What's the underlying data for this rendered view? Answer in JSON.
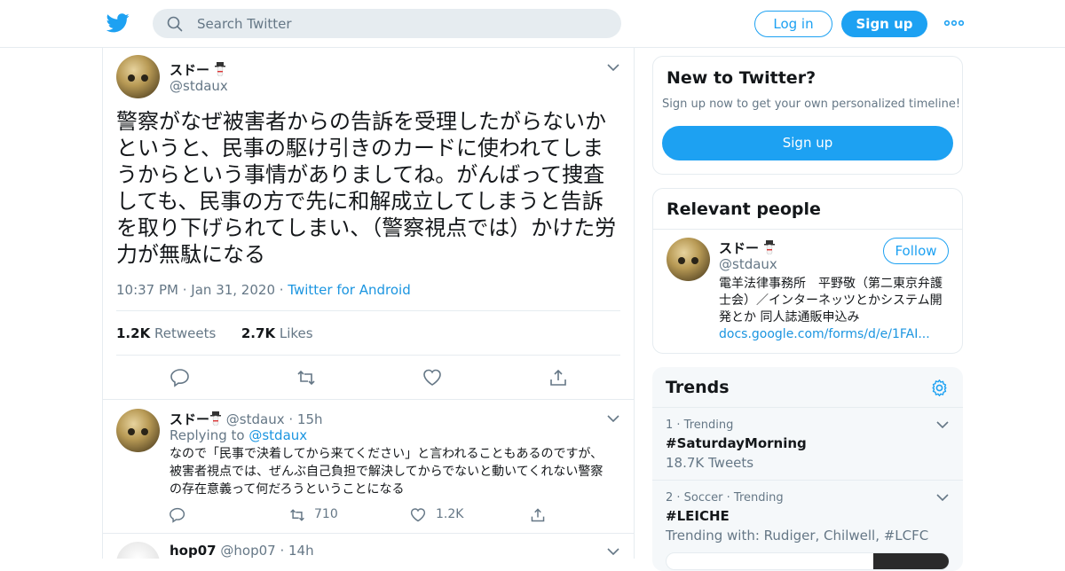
{
  "header": {
    "search_placeholder": "Search Twitter",
    "login_label": "Log in",
    "signup_label": "Sign up",
    "brand_color": "#1da1f2"
  },
  "tweet": {
    "author_name": "スドー",
    "author_handle": "@stdaux",
    "text": "警察がなぜ被害者からの告訴を受理したがらないかというと、民事の駆け引きのカードに使われてしまうからという事情がありましてね。がんばって捜査しても、民事の方で先に和解成立してしまうと告訴を取り下げられてしまい、（警察視点では）かけた労力が無駄になる",
    "time": "10:37 PM",
    "date": "Jan 31, 2020",
    "source": "Twitter for Android",
    "retweets_count": "1.2K",
    "retweets_label": "Retweets",
    "likes_count": "2.7K",
    "likes_label": "Likes"
  },
  "reply1": {
    "author_name": "スドー",
    "author_handle": "@stdaux",
    "age": "15h",
    "replying_prefix": "Replying to",
    "replying_to": "@stdaux",
    "text": "なので「民事で決着してから来てください」と言われることもあるのですが、被害者視点では、ぜんぶ自己負担で解決してからでないと動いてくれない警察の存在意義って何だろうということになる",
    "retweets": "710",
    "likes": "1.2K"
  },
  "reply2": {
    "author_name": "hop07",
    "author_handle": "@hop07",
    "age": "14h"
  },
  "sidebar": {
    "new_title": "New to Twitter?",
    "new_sub": "Sign up now to get your own personalized timeline!",
    "new_signup": "Sign up",
    "relevant_title": "Relevant people",
    "person_name": "スドー",
    "person_handle": "@stdaux",
    "follow_label": "Follow",
    "person_bio": "電羊法律事務所　平野敬（第二東京弁護士会）／インターネッツとかシステム開発とか 同人誌通販申込み",
    "person_link": "docs.google.com/forms/d/e/1FAI...",
    "trends_title": "Trends",
    "trends": [
      {
        "meta": "1 · Trending",
        "tag": "#SaturdayMorning",
        "sub": "18.7K Tweets"
      },
      {
        "meta": "2 · Soccer · Trending",
        "tag": "#LEICHE",
        "sub": "Trending with: Rudiger, Chilwell, #LCFC"
      }
    ]
  },
  "icons": [
    "twitter-bird-icon",
    "search-icon",
    "more-icon",
    "chevron-down-icon",
    "reply-icon",
    "retweet-icon",
    "like-icon",
    "share-icon",
    "gear-icon",
    "snowman-emoji-icon"
  ]
}
